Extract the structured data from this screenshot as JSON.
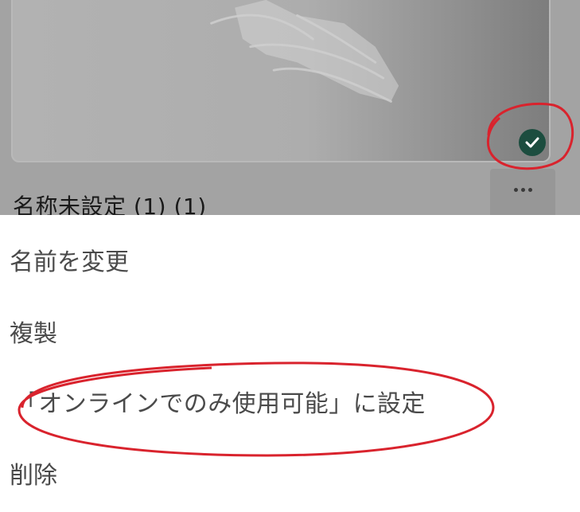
{
  "card": {
    "title": "名称未設定 (1) (1)",
    "status_icon": "check-circle-icon",
    "more_icon": "ellipsis-icon"
  },
  "menu": {
    "items": [
      {
        "label": "名前を変更"
      },
      {
        "label": "複製"
      },
      {
        "label": "「オンラインでのみ使用可能」に設定"
      },
      {
        "label": "削除"
      }
    ]
  },
  "colors": {
    "overlay_dim": "#a3a3a3",
    "badge": "#1c4d3f",
    "annotation_red": "#d9232d",
    "menu_text": "#4a4a4a"
  }
}
